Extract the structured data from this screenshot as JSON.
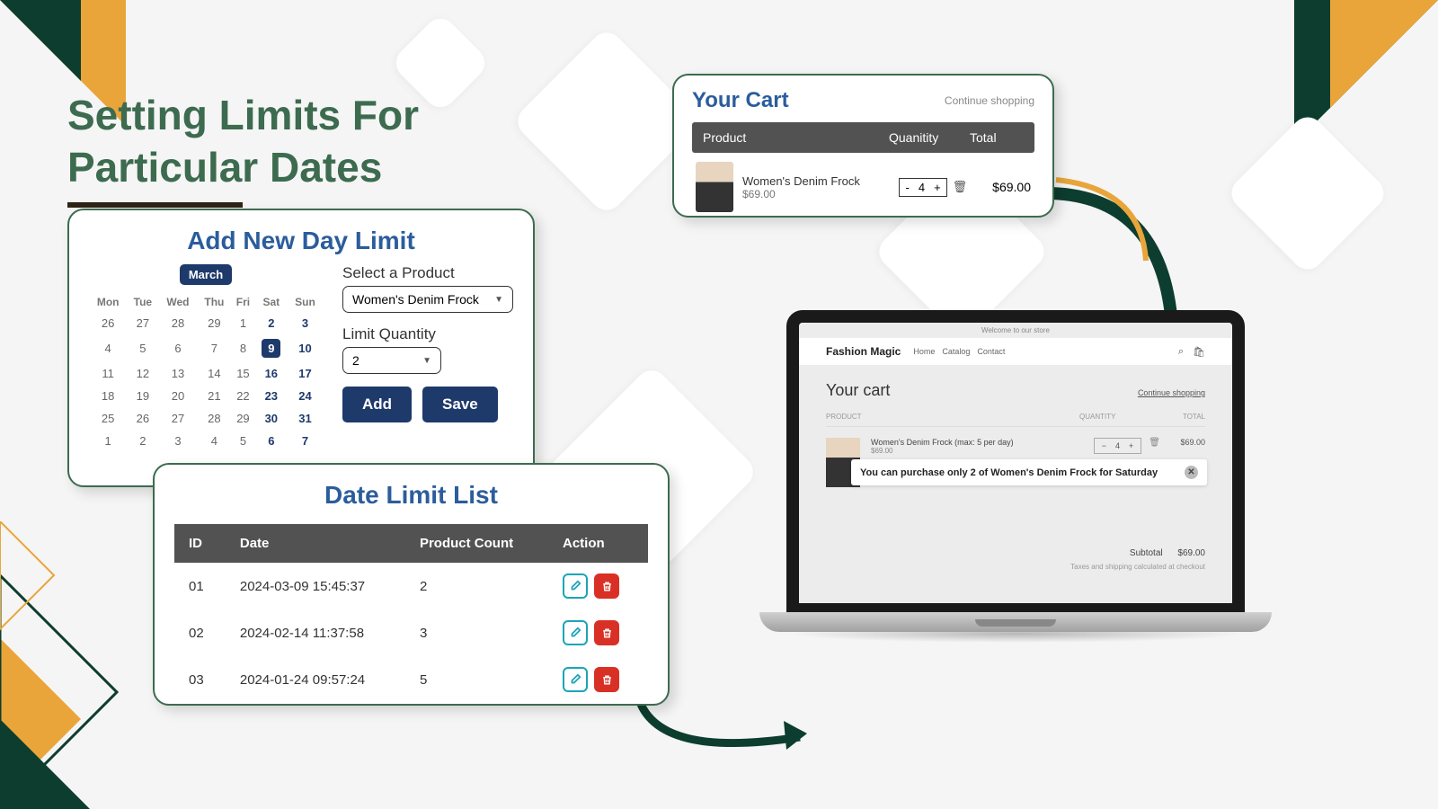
{
  "heading": {
    "line1": "Setting Limits For",
    "line2": "Particular Dates"
  },
  "addLimit": {
    "title": "Add New Day Limit",
    "month": "March",
    "days": [
      "Mon",
      "Tue",
      "Wed",
      "Thu",
      "Fri",
      "Sat",
      "Sun"
    ],
    "weeks": [
      [
        {
          "n": "26"
        },
        {
          "n": "27"
        },
        {
          "n": "28"
        },
        {
          "n": "29"
        },
        {
          "n": "1"
        },
        {
          "n": "2",
          "w": true
        },
        {
          "n": "3",
          "w": true
        }
      ],
      [
        {
          "n": "4"
        },
        {
          "n": "5"
        },
        {
          "n": "6"
        },
        {
          "n": "7"
        },
        {
          "n": "8"
        },
        {
          "n": "9",
          "w": true,
          "sel": true
        },
        {
          "n": "10",
          "w": true
        }
      ],
      [
        {
          "n": "11"
        },
        {
          "n": "12"
        },
        {
          "n": "13"
        },
        {
          "n": "14"
        },
        {
          "n": "15"
        },
        {
          "n": "16",
          "w": true
        },
        {
          "n": "17",
          "w": true
        }
      ],
      [
        {
          "n": "18"
        },
        {
          "n": "19"
        },
        {
          "n": "20"
        },
        {
          "n": "21"
        },
        {
          "n": "22"
        },
        {
          "n": "23",
          "w": true
        },
        {
          "n": "24",
          "w": true
        }
      ],
      [
        {
          "n": "25"
        },
        {
          "n": "26"
        },
        {
          "n": "27"
        },
        {
          "n": "28"
        },
        {
          "n": "29"
        },
        {
          "n": "30",
          "w": true
        },
        {
          "n": "31",
          "w": true
        }
      ],
      [
        {
          "n": "1"
        },
        {
          "n": "2"
        },
        {
          "n": "3"
        },
        {
          "n": "4"
        },
        {
          "n": "5"
        },
        {
          "n": "6",
          "w": true
        },
        {
          "n": "7",
          "w": true
        }
      ]
    ],
    "productLabel": "Select a Product",
    "productValue": "Women's Denim Frock",
    "qtyLabel": "Limit Quantity",
    "qtyValue": "2",
    "addBtn": "Add",
    "saveBtn": "Save"
  },
  "list": {
    "title": "Date Limit List",
    "cols": {
      "id": "ID",
      "date": "Date",
      "count": "Product Count",
      "action": "Action"
    },
    "rows": [
      {
        "id": "01",
        "date": "2024-03-09 15:45:37",
        "count": "2"
      },
      {
        "id": "02",
        "date": "2024-02-14 11:37:58",
        "count": "3"
      },
      {
        "id": "03",
        "date": "2024-01-24 09:57:24",
        "count": "5"
      }
    ]
  },
  "cart": {
    "title": "Your Cart",
    "continue": "Continue shopping",
    "cols": {
      "product": "Product",
      "qty": "Quanitity",
      "total": "Total"
    },
    "item": {
      "name": "Women's Denim Frock",
      "price": "$69.00",
      "qty": "4",
      "total": "$69.00"
    }
  },
  "store": {
    "banner": "Welcome to our store",
    "brand": "Fashion Magic",
    "nav": [
      "Home",
      "Catalog",
      "Contact"
    ],
    "cartTitle": "Your cart",
    "continue": "Continue shopping",
    "cols": {
      "product": "PRODUCT",
      "qty": "QUANTITY",
      "total": "TOTAL"
    },
    "item": {
      "name": "Women's Denim Frock (max: 5 per day)",
      "price": "$69.00",
      "qty": "4",
      "total": "$69.00"
    },
    "alert": "You can purchase only 2 of Women's Denim Frock for Saturday",
    "subtotalLabel": "Subtotal",
    "subtotal": "$69.00",
    "tax": "Taxes and shipping calculated at checkout"
  }
}
